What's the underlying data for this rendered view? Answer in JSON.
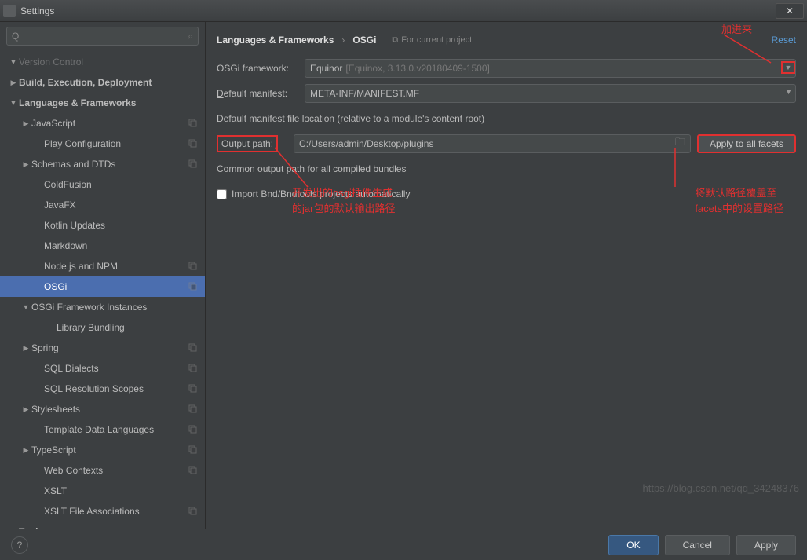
{
  "window": {
    "title": "Settings"
  },
  "search": {
    "placeholder": "Q"
  },
  "tree": [
    {
      "label": "Version Control",
      "level": 0,
      "arrow": "▼",
      "copy": false,
      "dim": true
    },
    {
      "label": "Build, Execution, Deployment",
      "level": 0,
      "arrow": "▶",
      "copy": false,
      "bold": true
    },
    {
      "label": "Languages & Frameworks",
      "level": 0,
      "arrow": "▼",
      "copy": false,
      "bold": true
    },
    {
      "label": "JavaScript",
      "level": 1,
      "arrow": "▶",
      "copy": true
    },
    {
      "label": "Play Configuration",
      "level": 2,
      "arrow": "",
      "copy": true
    },
    {
      "label": "Schemas and DTDs",
      "level": 1,
      "arrow": "▶",
      "copy": true
    },
    {
      "label": "ColdFusion",
      "level": 2,
      "arrow": "",
      "copy": false
    },
    {
      "label": "JavaFX",
      "level": 2,
      "arrow": "",
      "copy": false
    },
    {
      "label": "Kotlin Updates",
      "level": 2,
      "arrow": "",
      "copy": false
    },
    {
      "label": "Markdown",
      "level": 2,
      "arrow": "",
      "copy": false
    },
    {
      "label": "Node.js and NPM",
      "level": 2,
      "arrow": "",
      "copy": true
    },
    {
      "label": "OSGi",
      "level": 2,
      "arrow": "",
      "copy": true,
      "selected": true
    },
    {
      "label": "OSGi Framework Instances",
      "level": 1,
      "arrow": "▼",
      "copy": false
    },
    {
      "label": "Library Bundling",
      "level": 3,
      "arrow": "",
      "copy": false
    },
    {
      "label": "Spring",
      "level": 1,
      "arrow": "▶",
      "copy": true
    },
    {
      "label": "SQL Dialects",
      "level": 2,
      "arrow": "",
      "copy": true
    },
    {
      "label": "SQL Resolution Scopes",
      "level": 2,
      "arrow": "",
      "copy": true
    },
    {
      "label": "Stylesheets",
      "level": 1,
      "arrow": "▶",
      "copy": true
    },
    {
      "label": "Template Data Languages",
      "level": 2,
      "arrow": "",
      "copy": true
    },
    {
      "label": "TypeScript",
      "level": 1,
      "arrow": "▶",
      "copy": true
    },
    {
      "label": "Web Contexts",
      "level": 2,
      "arrow": "",
      "copy": true
    },
    {
      "label": "XSLT",
      "level": 2,
      "arrow": "",
      "copy": false
    },
    {
      "label": "XSLT File Associations",
      "level": 2,
      "arrow": "",
      "copy": true
    },
    {
      "label": "Tools",
      "level": 0,
      "arrow": "▶",
      "copy": false,
      "bold": true
    }
  ],
  "breadcrumb": {
    "a": "Languages & Frameworks",
    "b": "OSGi",
    "scope": "For current project",
    "reset": "Reset"
  },
  "form": {
    "framework_label": "OSGi framework:",
    "framework_value": "Equinor",
    "framework_detail": "[Equinox, 3.13.0.v20180409-1500]",
    "manifest_label_pre": "D",
    "manifest_label_post": "efault manifest:",
    "manifest_value": "META-INF/MANIFEST.MF",
    "manifest_hint": "Default manifest file location (relative to a module's content root)",
    "output_label": "Output path:",
    "output_value": "C:/Users/admin/Desktop/plugins",
    "output_hint": "Common output path for all compiled bundles",
    "apply_facets": "Apply  to all facets",
    "import_label": "Import Bnd/Bndtools projects automatically"
  },
  "annotations": {
    "a1": "加进来",
    "a2_line1": "开发出的osgi插件生成",
    "a2_line2": "的jar包的默认输出路径",
    "a3_line1": "将默认路径覆盖至",
    "a3_line2": "facets中的设置路径"
  },
  "footer": {
    "ok": "OK",
    "cancel": "Cancel",
    "apply": "Apply"
  },
  "watermark": "https://blog.csdn.net/qq_34248376"
}
